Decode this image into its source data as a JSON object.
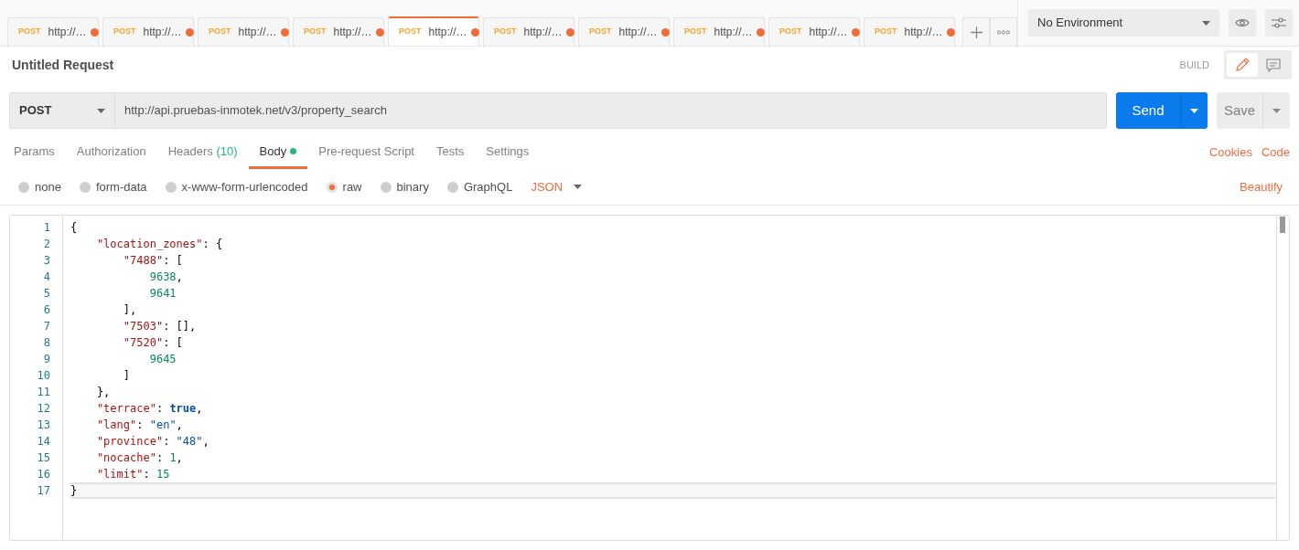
{
  "tabs": [
    {
      "method": "POST",
      "label": "http://…",
      "unsaved": true,
      "selected": false
    },
    {
      "method": "POST",
      "label": "http://…",
      "unsaved": true,
      "selected": false
    },
    {
      "method": "POST",
      "label": "http://…",
      "unsaved": true,
      "selected": false
    },
    {
      "method": "POST",
      "label": "http://…",
      "unsaved": true,
      "selected": false
    },
    {
      "method": "POST",
      "label": "http://…",
      "unsaved": true,
      "selected": true
    },
    {
      "method": "POST",
      "label": "http://…",
      "unsaved": true,
      "selected": false
    },
    {
      "method": "POST",
      "label": "http://…",
      "unsaved": true,
      "selected": false
    },
    {
      "method": "POST",
      "label": "http://…",
      "unsaved": true,
      "selected": false
    },
    {
      "method": "POST",
      "label": "http://…",
      "unsaved": true,
      "selected": false
    },
    {
      "method": "POST",
      "label": "http://…",
      "unsaved": true,
      "selected": false
    }
  ],
  "environment": "No Environment",
  "request": {
    "title": "Untitled Request",
    "mode": "BUILD",
    "method": "POST",
    "url": "http://api.pruebas-inmotek.net/v3/property_search",
    "send": "Send",
    "save": "Save"
  },
  "request_tabs": [
    {
      "label": "Params",
      "selected": false
    },
    {
      "label": "Authorization",
      "selected": false
    },
    {
      "label": "Headers",
      "count": "(10)",
      "selected": false
    },
    {
      "label": "Body",
      "has_content": true,
      "selected": true
    },
    {
      "label": "Pre-request Script",
      "selected": false
    },
    {
      "label": "Tests",
      "selected": false
    },
    {
      "label": "Settings",
      "selected": false
    }
  ],
  "links": [
    "Cookies",
    "Code"
  ],
  "body_types": [
    {
      "label": "none",
      "selected": false
    },
    {
      "label": "form-data",
      "selected": false
    },
    {
      "label": "x-www-form-urlencoded",
      "selected": false
    },
    {
      "label": "raw",
      "selected": true
    },
    {
      "label": "binary",
      "selected": false
    },
    {
      "label": "GraphQL",
      "selected": false
    }
  ],
  "format": "JSON",
  "beautify": "Beautify",
  "editor": {
    "lines": [
      {
        "number": "1",
        "active": false,
        "tokens": [
          {
            "kind": "punct",
            "text": "{"
          }
        ]
      },
      {
        "number": "2",
        "active": false,
        "tokens": [
          {
            "kind": "key",
            "text": "    \"location_zones\""
          },
          {
            "kind": "punct",
            "text": ": {"
          }
        ]
      },
      {
        "number": "3",
        "active": false,
        "tokens": [
          {
            "kind": "key",
            "text": "        \"7488\""
          },
          {
            "kind": "punct",
            "text": ": ["
          }
        ]
      },
      {
        "number": "4",
        "active": false,
        "tokens": [
          {
            "kind": "num",
            "text": "            9638"
          },
          {
            "kind": "punct",
            "text": ","
          }
        ]
      },
      {
        "number": "5",
        "active": false,
        "tokens": [
          {
            "kind": "num",
            "text": "            9641"
          }
        ]
      },
      {
        "number": "6",
        "active": false,
        "tokens": [
          {
            "kind": "punct",
            "text": "        ],"
          }
        ]
      },
      {
        "number": "7",
        "active": false,
        "tokens": [
          {
            "kind": "key",
            "text": "        \"7503\""
          },
          {
            "kind": "punct",
            "text": ": [],"
          }
        ]
      },
      {
        "number": "8",
        "active": false,
        "tokens": [
          {
            "kind": "key",
            "text": "        \"7520\""
          },
          {
            "kind": "punct",
            "text": ": ["
          }
        ]
      },
      {
        "number": "9",
        "active": false,
        "tokens": [
          {
            "kind": "num",
            "text": "            9645"
          }
        ]
      },
      {
        "number": "10",
        "active": false,
        "tokens": [
          {
            "kind": "punct",
            "text": "        ]"
          }
        ]
      },
      {
        "number": "11",
        "active": false,
        "tokens": [
          {
            "kind": "punct",
            "text": "    },"
          }
        ]
      },
      {
        "number": "12",
        "active": false,
        "tokens": [
          {
            "kind": "key",
            "text": "    \"terrace\""
          },
          {
            "kind": "punct",
            "text": ": "
          },
          {
            "kind": "bool",
            "text": "true"
          },
          {
            "kind": "punct",
            "text": ","
          }
        ]
      },
      {
        "number": "13",
        "active": false,
        "tokens": [
          {
            "kind": "key",
            "text": "    \"lang\""
          },
          {
            "kind": "punct",
            "text": ": "
          },
          {
            "kind": "str",
            "text": "\"en\""
          },
          {
            "kind": "punct",
            "text": ","
          }
        ]
      },
      {
        "number": "14",
        "active": false,
        "tokens": [
          {
            "kind": "key",
            "text": "    \"province\""
          },
          {
            "kind": "punct",
            "text": ": "
          },
          {
            "kind": "str",
            "text": "\"48\""
          },
          {
            "kind": "punct",
            "text": ","
          }
        ]
      },
      {
        "number": "15",
        "active": false,
        "tokens": [
          {
            "kind": "key",
            "text": "    \"nocache\""
          },
          {
            "kind": "punct",
            "text": ": "
          },
          {
            "kind": "num",
            "text": "1"
          },
          {
            "kind": "punct",
            "text": ","
          }
        ]
      },
      {
        "number": "16",
        "active": false,
        "tokens": [
          {
            "kind": "key",
            "text": "    \"limit\""
          },
          {
            "kind": "punct",
            "text": ": "
          },
          {
            "kind": "num",
            "text": "15"
          }
        ]
      },
      {
        "number": "17",
        "active": true,
        "tokens": [
          {
            "kind": "punct",
            "text": "}"
          }
        ]
      }
    ]
  }
}
